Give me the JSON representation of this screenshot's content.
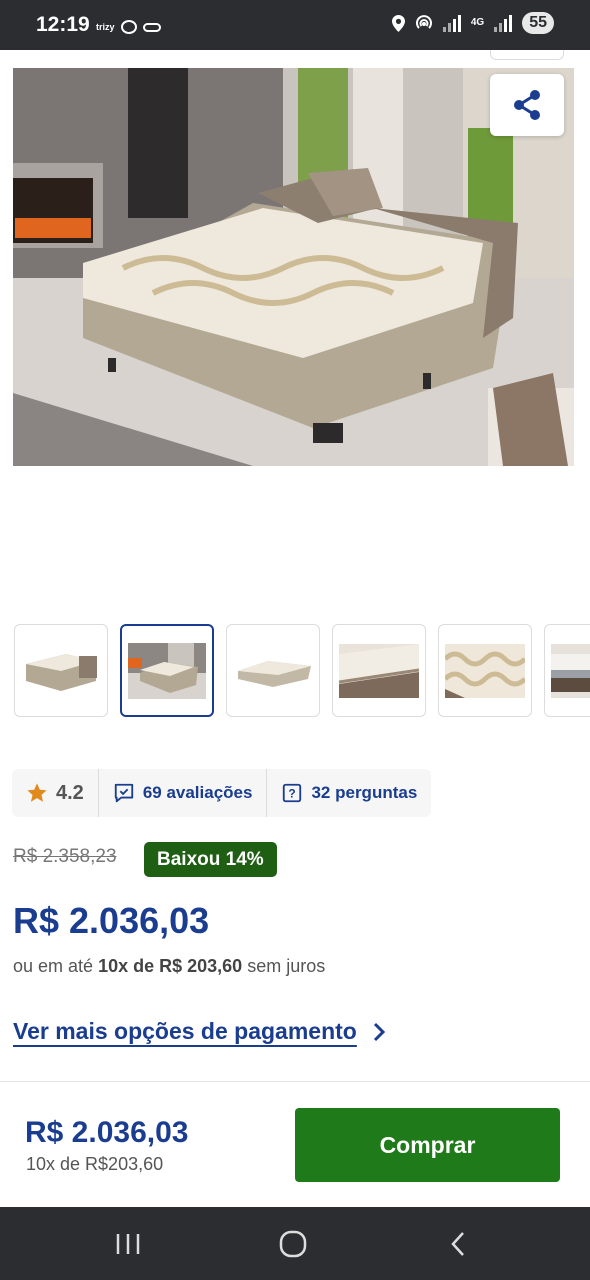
{
  "status_bar": {
    "time": "12:19",
    "notification_text": "trizy",
    "network": "4G",
    "battery": "55"
  },
  "product": {
    "rating": "4.2",
    "reviews_label": "69 avaliações",
    "questions_label": "32 perguntas",
    "old_price": "R$ 2.358,23",
    "discount_badge": "Baixou 14%",
    "price": "R$ 2.036,03",
    "installments_prefix": "ou em até",
    "installments_bold": "10x de R$ 203,60",
    "installments_suffix": "sem juros",
    "more_payment_link": "Ver mais opções de pagamento"
  },
  "bottom_bar": {
    "price": "R$ 2.036,03",
    "installments": "10x de R$203,60",
    "buy_label": "Comprar"
  },
  "gallery": {
    "thumbnail_count": 6,
    "active_index": 1
  },
  "colors": {
    "brand_blue": "#1a3d8f",
    "buy_green": "#1f7a1a",
    "badge_green": "#1f5f13",
    "star": "#e08a1e"
  }
}
